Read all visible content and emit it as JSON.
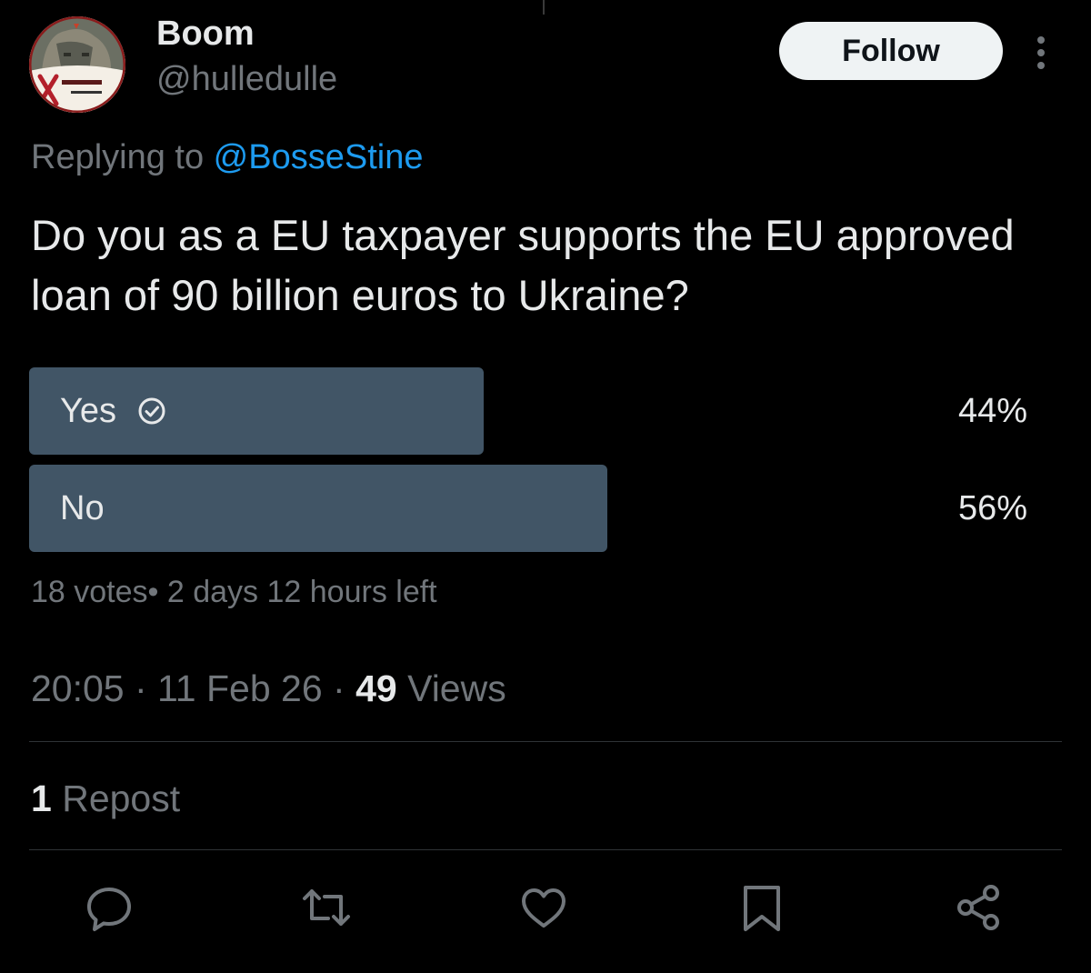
{
  "author": {
    "name": "Boom",
    "handle": "@hulledulle",
    "avatar_icon": "profile-picture"
  },
  "follow_button": {
    "label": "Follow"
  },
  "more_icon": "more-vertical-icon",
  "replying": {
    "prefix": "Replying to ",
    "mention": "@BosseStine"
  },
  "tweet": {
    "text": "Do you as a EU taxpayer supports the EU approved loan of 90 billion euros to Ukraine?"
  },
  "poll": {
    "options": [
      {
        "label": "Yes",
        "percent_label": "44%",
        "percent": 44,
        "selected": true
      },
      {
        "label": "No",
        "percent_label": "56%",
        "percent": 56,
        "selected": false
      }
    ],
    "meta": "18 votes• 2 days 12 hours left"
  },
  "timestamp": {
    "time": "20:05",
    "sep1": " · ",
    "date": "11 Feb 26",
    "sep2": " · ",
    "views_count": "49",
    "views_label": " Views"
  },
  "reposts": {
    "count": "1",
    "label": " Repost"
  },
  "actions": [
    "reply-icon",
    "retweet-icon",
    "like-icon",
    "bookmark-icon",
    "share-icon"
  ],
  "colors": {
    "background": "#000000",
    "text": "#e7e9ea",
    "secondary_text": "#71767b",
    "link": "#1d9bf0",
    "poll_fill": "#415566",
    "follow_bg": "#eff3f4"
  }
}
